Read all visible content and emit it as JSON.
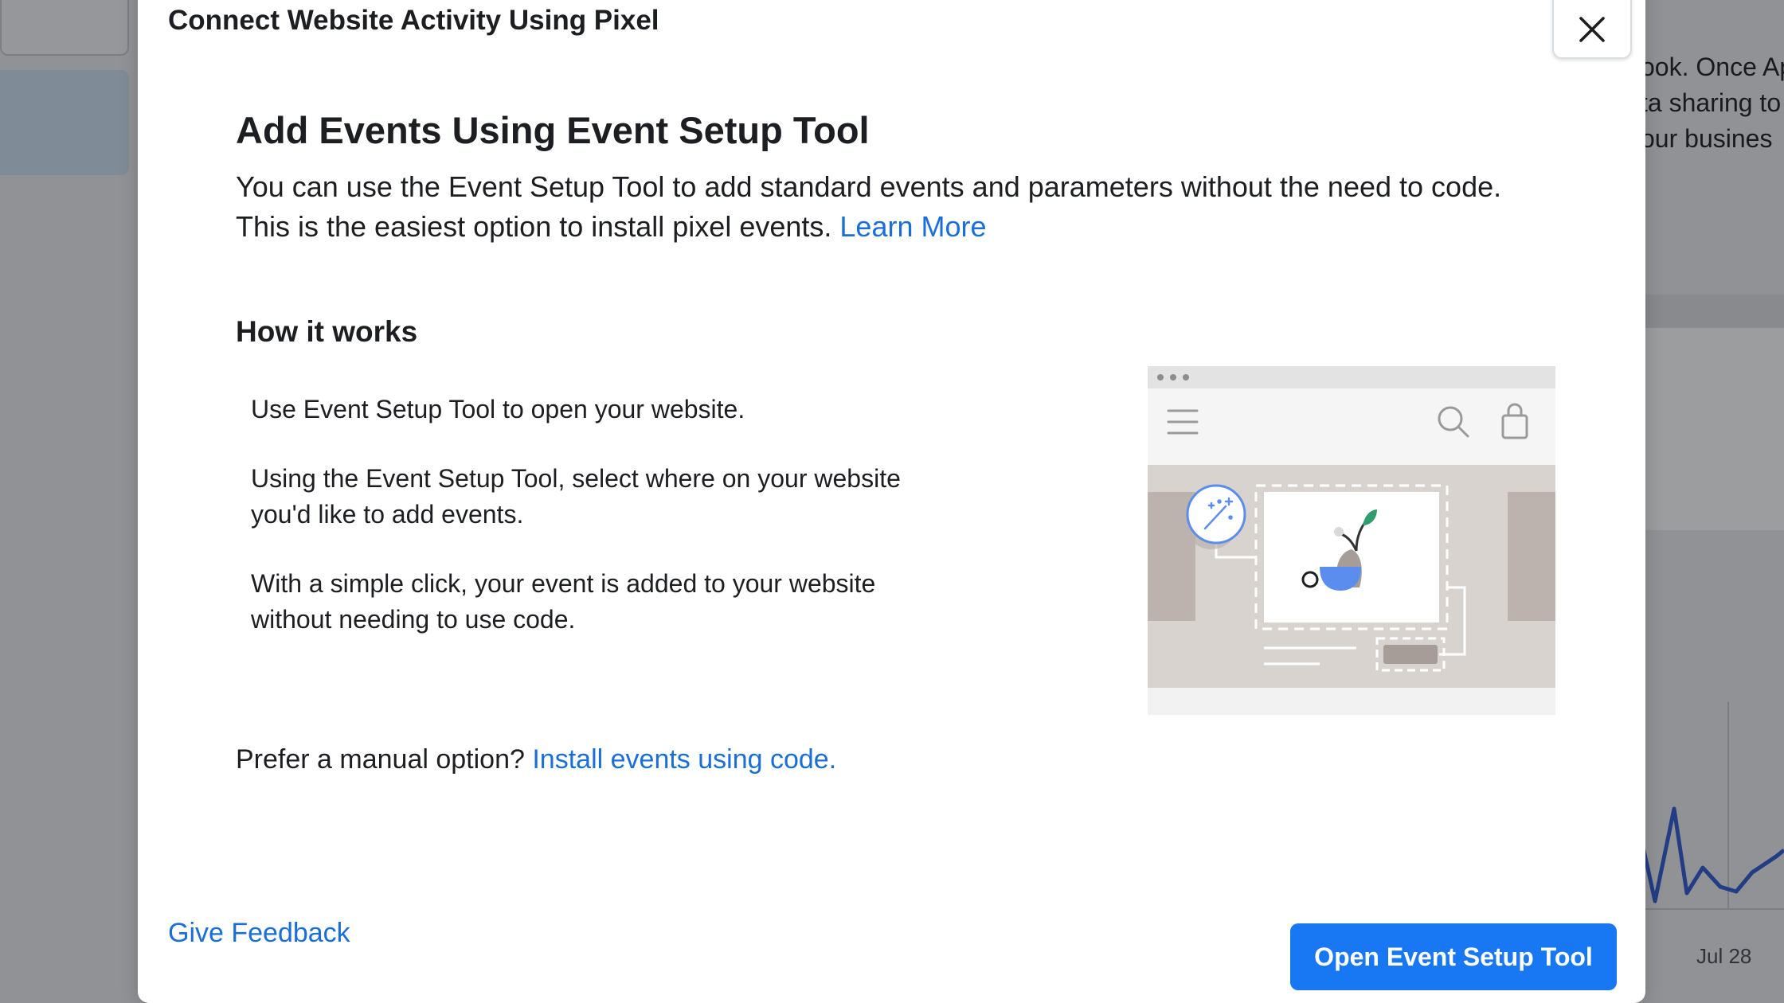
{
  "background": {
    "side_text_lines": [
      "ook. Once Ap",
      "ta sharing to",
      "our busines"
    ],
    "chart_axis_label": "Jul 28"
  },
  "modal": {
    "title": "Connect Website Activity Using Pixel",
    "close_icon": "close-icon",
    "heading": "Add Events Using Event Setup Tool",
    "description": "You can use the Event Setup Tool to add standard events and parameters without the need to code. This is the easiest option to install pixel events.",
    "learn_more_label": "Learn More",
    "how_heading": "How it works",
    "steps": [
      "Use Event Setup Tool to open your website.",
      "Using the Event Setup Tool, select where on your website you'd like to add events.",
      "With a simple click, your event is added to your website without needing to use code."
    ],
    "manual_prefix": "Prefer a manual option?",
    "manual_link_label": "Install events using code.",
    "feedback_label": "Give Feedback",
    "primary_button_label": "Open Event Setup Tool"
  },
  "colors": {
    "link": "#1a6ed8",
    "primary_button": "#1877f2",
    "illustration_accent_blue": "#5b8def",
    "illustration_leaf": "#2f9e6e"
  }
}
